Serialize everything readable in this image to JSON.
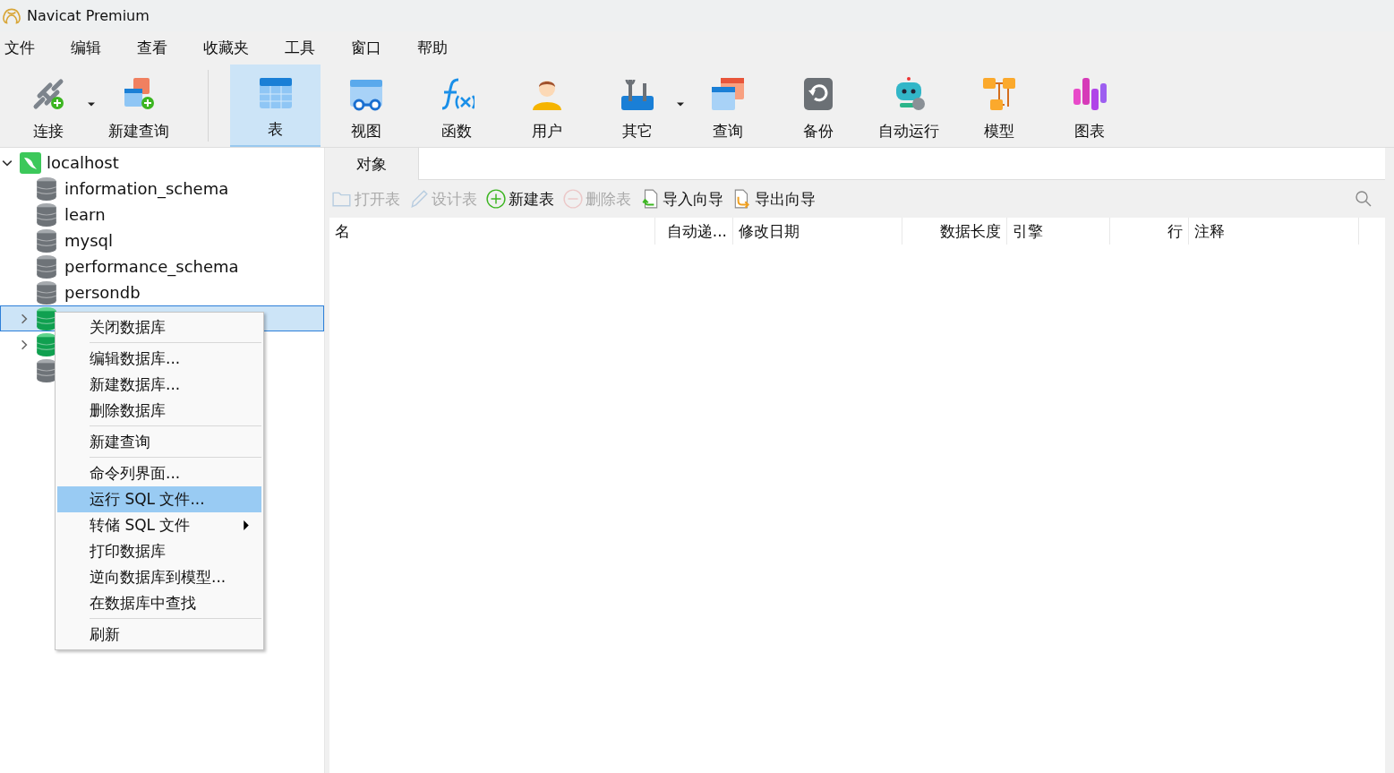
{
  "window": {
    "title": "Navicat Premium"
  },
  "menu": [
    "文件",
    "编辑",
    "查看",
    "收藏夹",
    "工具",
    "窗口",
    "帮助"
  ],
  "toolbar": [
    {
      "kind": "connect",
      "label": "连接",
      "selected": false,
      "dropdown": true
    },
    {
      "kind": "new-query",
      "label": "新建查询",
      "selected": false,
      "dropdown": false
    },
    {
      "kind": "table",
      "label": "表",
      "selected": true,
      "dropdown": false
    },
    {
      "kind": "view",
      "label": "视图",
      "selected": false,
      "dropdown": false
    },
    {
      "kind": "function",
      "label": "函数",
      "selected": false,
      "dropdown": false
    },
    {
      "kind": "user",
      "label": "用户",
      "selected": false,
      "dropdown": false
    },
    {
      "kind": "other",
      "label": "其它",
      "selected": false,
      "dropdown": true
    },
    {
      "kind": "query",
      "label": "查询",
      "selected": false,
      "dropdown": false
    },
    {
      "kind": "backup",
      "label": "备份",
      "selected": false,
      "dropdown": false
    },
    {
      "kind": "automation",
      "label": "自动运行",
      "selected": false,
      "dropdown": false
    },
    {
      "kind": "model",
      "label": "模型",
      "selected": false,
      "dropdown": false
    },
    {
      "kind": "chart",
      "label": "图表",
      "selected": false,
      "dropdown": false
    }
  ],
  "tree": {
    "label": "localhost",
    "expanded": true,
    "children": [
      {
        "label": "information_schema",
        "open": false,
        "selected": false,
        "expandable": false
      },
      {
        "label": "learn",
        "open": false,
        "selected": false,
        "expandable": false
      },
      {
        "label": "mysql",
        "open": false,
        "selected": false,
        "expandable": false
      },
      {
        "label": "performance_schema",
        "open": false,
        "selected": false,
        "expandable": false
      },
      {
        "label": "persondb",
        "open": false,
        "selected": false,
        "expandable": false
      },
      {
        "open": true,
        "selected": true,
        "expandable": true
      },
      {
        "open": true,
        "selected": false,
        "expandable": true
      },
      {
        "open": false,
        "selected": false,
        "expandable": false
      }
    ]
  },
  "object_tab": {
    "label": "对象"
  },
  "actions": [
    {
      "kind": "open",
      "label": "打开表",
      "disabled": true
    },
    {
      "kind": "design",
      "label": "设计表",
      "disabled": true
    },
    {
      "kind": "add",
      "label": "新建表",
      "disabled": false
    },
    {
      "kind": "remove",
      "label": "删除表",
      "disabled": true
    },
    {
      "kind": "import",
      "label": "导入向导",
      "disabled": false
    },
    {
      "kind": "export",
      "label": "导出向导",
      "disabled": false
    }
  ],
  "columns": [
    {
      "label": "名"
    },
    {
      "label": "自动递..."
    },
    {
      "label": "修改日期"
    },
    {
      "label": "数据长度"
    },
    {
      "label": "引擎"
    },
    {
      "label": "行"
    },
    {
      "label": "注释"
    }
  ],
  "context_menu": [
    {
      "label": "关闭数据库",
      "selected": false,
      "submenu": false,
      "separator_before": false
    },
    {
      "label": "编辑数据库...",
      "selected": false,
      "submenu": false,
      "separator_before": true
    },
    {
      "label": "新建数据库...",
      "selected": false,
      "submenu": false,
      "separator_before": false
    },
    {
      "label": "删除数据库",
      "selected": false,
      "submenu": false,
      "separator_before": false
    },
    {
      "label": "新建查询",
      "selected": false,
      "submenu": false,
      "separator_before": true
    },
    {
      "label": "命令列界面...",
      "selected": false,
      "submenu": false,
      "separator_before": true
    },
    {
      "label": "运行 SQL 文件...",
      "selected": true,
      "submenu": false,
      "separator_before": false
    },
    {
      "label": "转储 SQL 文件",
      "selected": false,
      "submenu": true,
      "separator_before": false
    },
    {
      "label": "打印数据库",
      "selected": false,
      "submenu": false,
      "separator_before": false
    },
    {
      "label": "逆向数据库到模型...",
      "selected": false,
      "submenu": false,
      "separator_before": false
    },
    {
      "label": "在数据库中查找",
      "selected": false,
      "submenu": false,
      "separator_before": false
    },
    {
      "label": "刷新",
      "selected": false,
      "submenu": false,
      "separator_before": true
    }
  ]
}
